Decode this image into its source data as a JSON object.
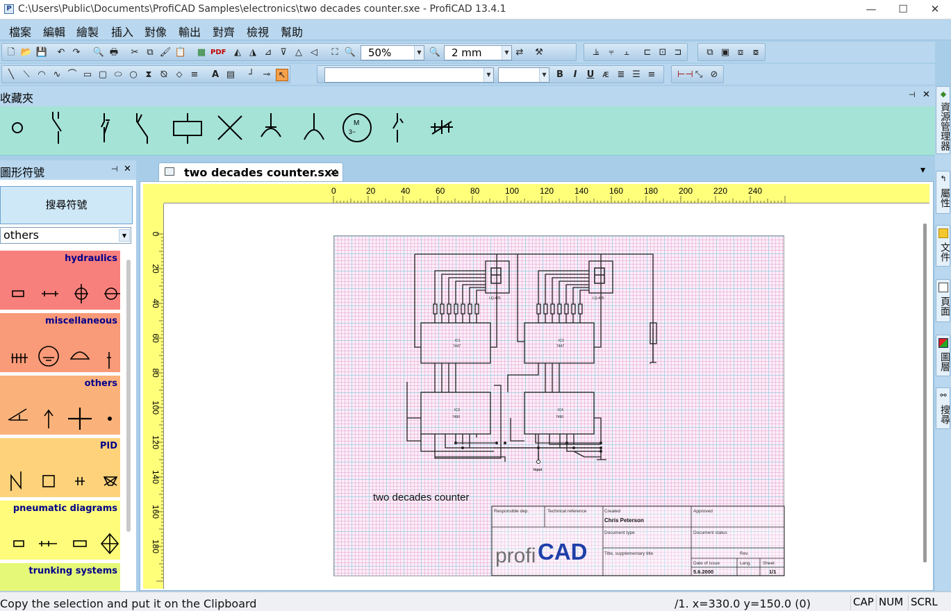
{
  "window": {
    "title": "C:\\Users\\Public\\Documents\\ProfiCAD Samples\\electronics\\two decades counter.sxe - ProfiCAD 13.4.1",
    "minimize_glyph": "—",
    "maximize_glyph": "☐",
    "close_glyph": "✕"
  },
  "menu": [
    "檔案",
    "編輯",
    "繪製",
    "插入",
    "對像",
    "輸出",
    "對齊",
    "檢視",
    "幫助"
  ],
  "toolbar": {
    "zoom_value": "50%",
    "grid_value": "2 mm",
    "font_name": "",
    "font_size": "",
    "pdf_label": "PDF",
    "bold_label": "B",
    "italic_label": "I",
    "underline_label": "U",
    "text_tool_label": "A"
  },
  "favorites": {
    "title": "收藏夾",
    "pin_glyph": "📌",
    "close_glyph": "✕"
  },
  "symbols_panel": {
    "title": "圖形符號",
    "search_button": "搜尋符號",
    "category_selected": "others",
    "categories": [
      {
        "name": "hydraulics",
        "color": "#f8807c"
      },
      {
        "name": "miscellaneous",
        "color": "#f99a78"
      },
      {
        "name": "others",
        "color": "#fbb27a"
      },
      {
        "name": "PID",
        "color": "#fdd27a"
      },
      {
        "name": "pneumatic diagrams",
        "color": "#fefc7a"
      },
      {
        "name": "trunking systems",
        "color": "#e6f878"
      }
    ]
  },
  "document": {
    "tab_label": "two decades counter.sxe",
    "tab_close": "×",
    "tablist_arrow": "▾",
    "ruler_h_ticks": [
      "0",
      "20",
      "40",
      "60",
      "80",
      "100",
      "120",
      "140",
      "160",
      "180",
      "200",
      "220",
      "240"
    ],
    "ruler_v_ticks": [
      "0",
      "20",
      "40",
      "60",
      "80",
      "100",
      "120",
      "140",
      "160",
      "180"
    ],
    "drawing_title": "two decades counter",
    "input_label": "Input",
    "ic_labels": [
      "IC1",
      "IC2",
      "IC3",
      "IC4"
    ],
    "ic_types": [
      "7447",
      "7447",
      "7490",
      "7490"
    ],
    "display_labels": [
      "LQ-425",
      "LQ-425"
    ],
    "title_block": {
      "responsible_dep": "Responsible dep.",
      "technical_reference": "Technical reference",
      "created": "Created",
      "created_by": "Chris Peterson",
      "approved": "Approved",
      "document_type": "Document type",
      "document_status": "Document status",
      "title_label": "Title, supplementary title",
      "rev": "Rev.",
      "date_of_issue": "Date of issue",
      "date_value": "5.6.2000",
      "lang": "Lang.",
      "sheet": "Sheet",
      "sheet_value": "1/1",
      "logo_left": "profi",
      "logo_right": "CAD"
    }
  },
  "right_tabs": [
    {
      "label": "資源管理器",
      "icon": "explorer-icon"
    },
    {
      "label": "屬性",
      "icon": "properties-icon"
    },
    {
      "label": "文件",
      "icon": "folder-icon"
    },
    {
      "label": "頁面",
      "icon": "page-icon"
    },
    {
      "label": "圖層",
      "icon": "layers-icon"
    },
    {
      "label": "搜尋",
      "icon": "binoculars-icon"
    }
  ],
  "status": {
    "message": "Copy the selection and put it on the Clipboard",
    "position": "/1.  x=330.0  y=150.0 (0)",
    "indicators": [
      "CAP",
      "NUM",
      "SCRL"
    ]
  }
}
